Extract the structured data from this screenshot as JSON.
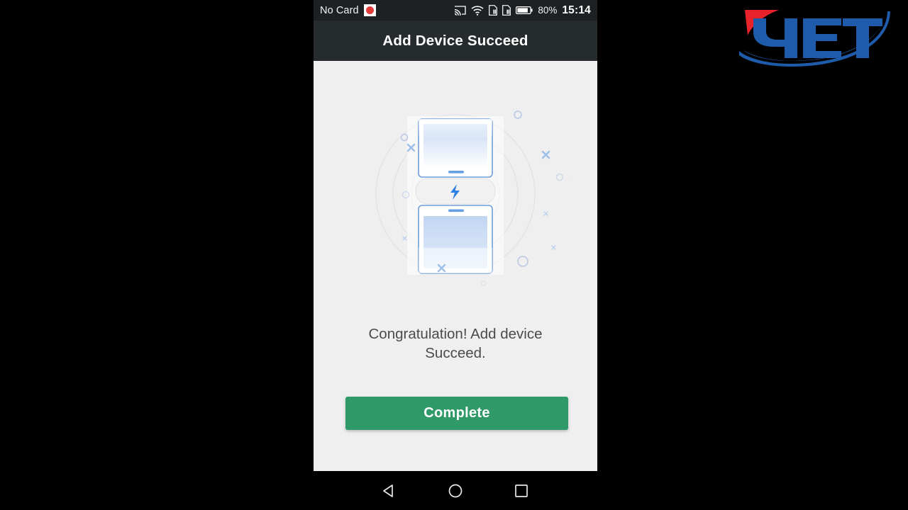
{
  "status_bar": {
    "card_label": "No Card",
    "rec_icon": "record-indicator-icon",
    "cast_icon": "cast-icon",
    "wifi_icon": "wifi-icon",
    "sim1_icon": "sim-card-1-icon",
    "sim2_icon": "sim-card-2-icon",
    "battery_icon": "battery-icon",
    "battery_percent": "80%",
    "clock": "15:14"
  },
  "title_bar": {
    "title": "Add Device Succeed"
  },
  "content": {
    "illustration_name": "two-phones-pairing-illustration",
    "message": "Congratulation! Add device Succeed.",
    "complete_label": "Complete"
  },
  "nav_bar": {
    "back_icon": "back-triangle-icon",
    "home_icon": "home-circle-icon",
    "recents_icon": "recents-square-icon"
  },
  "logo": {
    "name": "yet-brand-logo",
    "text": "YET"
  },
  "colors": {
    "accent_green": "#2f9a68",
    "illustration_blue": "#4a8fe0",
    "logo_blue": "#1f5bab",
    "logo_red": "#e8222a",
    "status_bar_bg": "#1d2123",
    "title_bar_bg": "#262b2d",
    "content_bg": "#efefef",
    "message_text": "#4b4b4b"
  }
}
